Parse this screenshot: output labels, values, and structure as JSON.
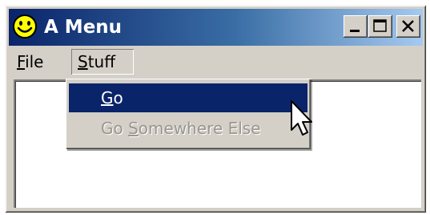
{
  "window": {
    "title": "A Menu",
    "icon": "smiley-icon",
    "caption_buttons": [
      "minimize-icon",
      "maximize-icon",
      "close-icon"
    ]
  },
  "menubar": {
    "items": [
      {
        "label": "File",
        "mnemonic_letter": "F",
        "rest": "ile"
      },
      {
        "label": "Stuff",
        "mnemonic_letter": "S",
        "rest": "tuff",
        "active": true
      }
    ]
  },
  "dropdown": {
    "items": [
      {
        "label": "Go",
        "pre": "",
        "mnemonic_letter": "G",
        "post": "o",
        "highlighted": true,
        "enabled": true
      },
      {
        "label": "Go Somewhere Else",
        "pre": "Go ",
        "mnemonic_letter": "S",
        "post": "omewhere Else",
        "highlighted": false,
        "enabled": false
      }
    ]
  },
  "colors": {
    "title_gradient_start": "#0a246a",
    "title_gradient_end": "#a6caf0",
    "menu_highlight": "#0a246a",
    "face": "#d4d0c8",
    "disabled_text": "#9a968e"
  }
}
